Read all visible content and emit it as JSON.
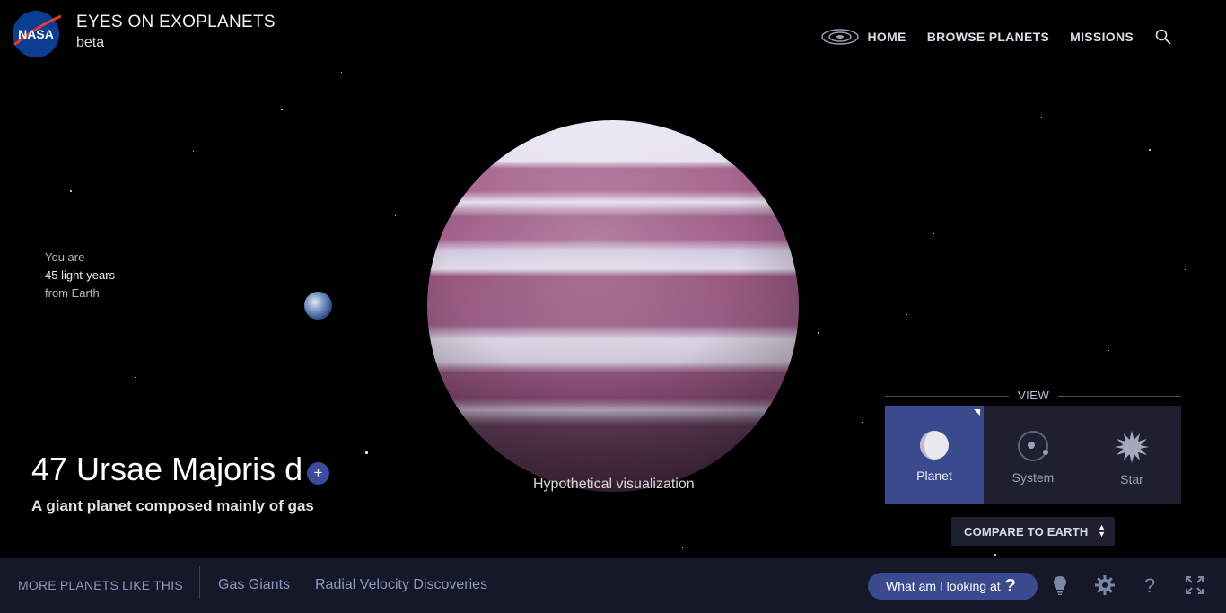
{
  "header": {
    "logo_text": "NASA",
    "title": "EYES ON EXOPLANETS",
    "subtitle": "beta",
    "nav": [
      "HOME",
      "BROWSE PLANETS",
      "MISSIONS"
    ]
  },
  "distance": {
    "line1": "You are",
    "line2": "45 light-years",
    "line3": "from Earth"
  },
  "planet": {
    "name": "47 Ursae Majoris d",
    "add_symbol": "+",
    "description": "A giant planet composed mainly of gas",
    "caption": "Hypothetical visualization"
  },
  "view": {
    "label": "VIEW",
    "options": [
      "Planet",
      "System",
      "Star"
    ],
    "selected": "Planet"
  },
  "compare": {
    "label": "COMPARE TO EARTH"
  },
  "bottom": {
    "more_label": "MORE PLANETS LIKE THIS",
    "links": [
      "Gas Giants",
      "Radial Velocity Discoveries"
    ],
    "what_button": "What am I looking at",
    "what_symbol": "?"
  },
  "colors": {
    "accent": "#3a4a8f",
    "panel": "#1e2030",
    "bottom_bar": "#141828"
  }
}
